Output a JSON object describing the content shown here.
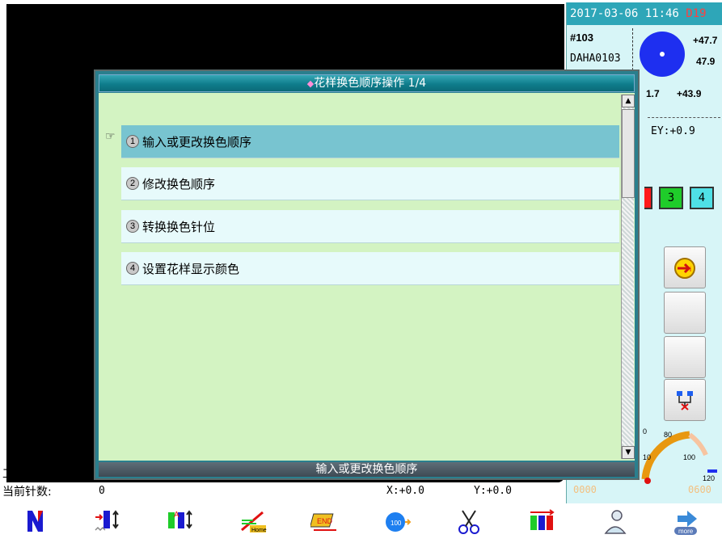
{
  "status_panel": {
    "datetime": "2017-03-06 11:46",
    "datetime_suffix": "D19",
    "design_no": "#103",
    "design_name": "DAHA0103",
    "dim_right_top": "+47.7",
    "dim_right_mid": "47.9",
    "dim_left": "1.7",
    "dim_right": "+43.9",
    "ey_readout": "EY:+0.9",
    "needles": [
      "3",
      "4"
    ],
    "gauge_labels": [
      "0",
      "80",
      "10",
      "100",
      "120"
    ],
    "counter_left": "0000",
    "counter_right": "0600",
    "colors": {
      "needle_red": "#ff1a1a",
      "needle_green": "#1fcc2a",
      "needle_cyan": "#4fe0e6"
    }
  },
  "dialog": {
    "title": "花样换色顺序操作 1/4",
    "items": [
      {
        "num": "1",
        "label": "输入或更改换色顺序",
        "selected": true
      },
      {
        "num": "2",
        "label": "修改换色顺序",
        "selected": false
      },
      {
        "num": "3",
        "label": "转换换色针位",
        "selected": false
      },
      {
        "num": "4",
        "label": "设置花样显示颜色",
        "selected": false
      }
    ],
    "status": "输入或更改换色顺序"
  },
  "bottom_status": {
    "piece_count_label": "工件数:",
    "current_stitch_label": "当前针数:",
    "current_stitch_value": "0",
    "x_readout": "X:+0.0",
    "y_readout": "Y:+0.0"
  },
  "toolbar": {
    "items": [
      {
        "icon": "pattern-icon"
      },
      {
        "icon": "frame-move-icon"
      },
      {
        "icon": "ab-switch-icon"
      },
      {
        "icon": "home-icon",
        "text": "Home"
      },
      {
        "icon": "end-icon",
        "text": "END"
      },
      {
        "icon": "speed-icon",
        "text": "100"
      },
      {
        "icon": "scissors-icon"
      },
      {
        "icon": "color-change-icon"
      },
      {
        "icon": "user-icon"
      },
      {
        "icon": "more-icon",
        "text": "more"
      }
    ]
  }
}
